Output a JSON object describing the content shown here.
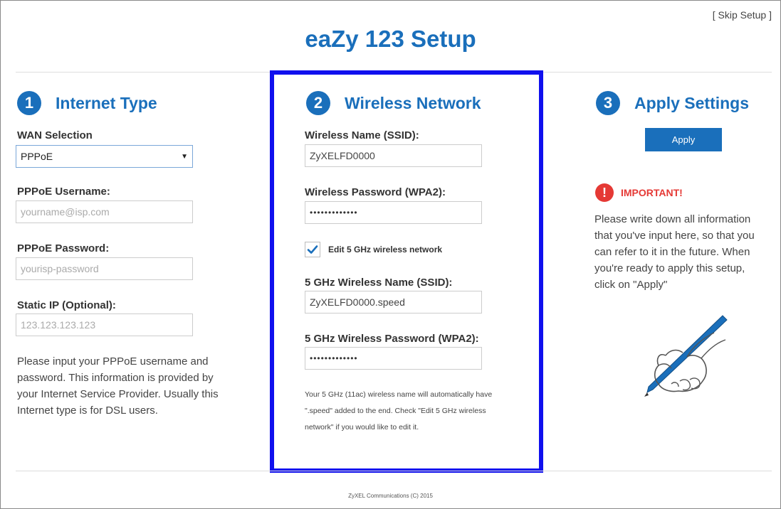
{
  "header": {
    "skip_label": "[ Skip Setup ]",
    "title": "eaZy 123 Setup"
  },
  "step1": {
    "number": "1",
    "title": "Internet Type",
    "wan_label": "WAN Selection",
    "wan_value": "PPPoE",
    "username_label": "PPPoE Username:",
    "username_placeholder": "yourname@isp.com",
    "password_label": "PPPoE Password:",
    "password_placeholder": "yourisp-password",
    "static_ip_label": "Static IP (Optional):",
    "static_ip_placeholder": "123.123.123.123",
    "help_lines": [
      "Please input your PPPoE username and",
      "password. This information is provided by",
      "your Internet Service Provider. Usually this",
      "Internet type is for DSL users."
    ]
  },
  "step2": {
    "number": "2",
    "title": "Wireless Network",
    "ssid_label": "Wireless Name (SSID):",
    "ssid_value": "ZyXELFD0000",
    "password_label": "Wireless Password (WPA2):",
    "password_value": "•••••••••••••",
    "edit5g_label": "Edit 5 GHz wireless network",
    "edit5g_checked": true,
    "ssid5_label": "5 GHz Wireless Name (SSID):",
    "ssid5_value": "ZyXELFD0000.speed",
    "password5_label": "5 GHz Wireless Password (WPA2):",
    "password5_value": "•••••••••••••",
    "note_lines": [
      "Your 5 GHz (11ac) wireless name will automatically have",
      "\".speed\" added to the end. Check \"Edit 5 GHz wireless",
      "network\" if you would like to edit it."
    ]
  },
  "step3": {
    "number": "3",
    "title": "Apply Settings",
    "apply_label": "Apply",
    "important_icon": "!",
    "important_label": "IMPORTANT!",
    "info_lines": [
      "Please write down all information",
      "that you've input here, so that you",
      "can refer to it in the future. When",
      "you're ready to apply this setup,",
      "click on \"Apply\""
    ]
  },
  "footer": {
    "copyright": "ZyXEL Communications (C) 2015"
  },
  "colors": {
    "brand_blue": "#1a6fbb",
    "highlight_border": "#1010ee",
    "important_red": "#e53935"
  }
}
